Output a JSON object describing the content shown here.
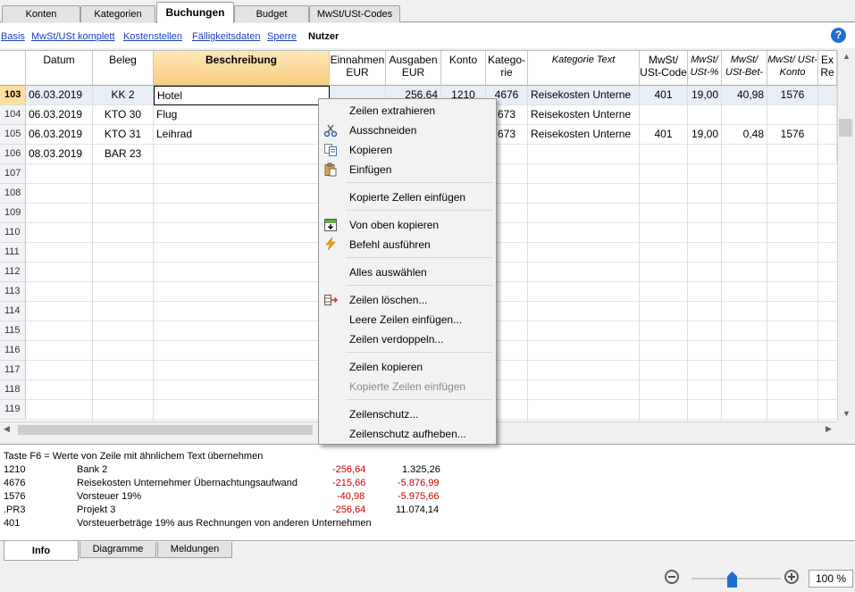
{
  "tabs": [
    "Konten",
    "Kategorien",
    "Buchungen",
    "Budget",
    "MwSt/USt-Codes"
  ],
  "views": [
    "Basis",
    "MwSt/USt komplett",
    "Kostenstellen",
    "Fälligkeitsdaten",
    "Sperre",
    "Nutzer"
  ],
  "columns": {
    "datum": "Datum",
    "beleg": "Beleg",
    "beschreibung": "Beschreibung",
    "einnahmen": "Einnahmen EUR",
    "ausgaben": "Ausgaben EUR",
    "konto": "Konto",
    "kategorie": "Katego-rie",
    "kategorie_text": "Kategorie Text",
    "mwst_code": "MwSt/ USt-Code",
    "mwst_pct": "MwSt/ USt-%",
    "mwst_bet": "MwSt/ USt-Bet-",
    "mwst_konto": "MwSt/ USt-Konto",
    "extra": "Ex Re"
  },
  "rows": [
    {
      "nr": "103",
      "datum": "06.03.2019",
      "beleg": "KK 2",
      "beschreibung": "Hotel",
      "einnahmen": "",
      "ausgaben": "256,64",
      "konto": "1210",
      "kategorie": "4676",
      "kategorie_text": "Reisekosten Unterne",
      "mwst_code": "401",
      "mwst_pct": "19,00",
      "mwst_bet": "40,98",
      "mwst_konto": "1576"
    },
    {
      "nr": "104",
      "datum": "06.03.2019",
      "beleg": "KTO 30",
      "beschreibung": "Flug",
      "einnahmen": "",
      "ausgaben": "",
      "konto": "",
      "kategorie": "673",
      "kategorie_text": "Reisekosten Unterne",
      "mwst_code": "",
      "mwst_pct": "",
      "mwst_bet": "",
      "mwst_konto": ""
    },
    {
      "nr": "105",
      "datum": "06.03.2019",
      "beleg": "KTO 31",
      "beschreibung": "Leihrad",
      "einnahmen": "",
      "ausgaben": "",
      "konto": "",
      "kategorie": "673",
      "kategorie_text": "Reisekosten Unterne",
      "mwst_code": "401",
      "mwst_pct": "19,00",
      "mwst_bet": "0,48",
      "mwst_konto": "1576"
    },
    {
      "nr": "106",
      "datum": "08.03.2019",
      "beleg": "BAR 23",
      "beschreibung": "",
      "einnahmen": "",
      "ausgaben": "",
      "konto": "",
      "kategorie": "",
      "kategorie_text": "",
      "mwst_code": "",
      "mwst_pct": "",
      "mwst_bet": "",
      "mwst_konto": ""
    }
  ],
  "empty_rows": [
    "107",
    "108",
    "109",
    "110",
    "111",
    "112",
    "113",
    "114",
    "115",
    "116",
    "117",
    "118",
    "119"
  ],
  "context_menu": {
    "zeilen_extrahieren": "Zeilen extrahieren",
    "ausschneiden": "Ausschneiden",
    "kopieren": "Kopieren",
    "einfuegen": "Einfügen",
    "kopierte_zellen_einfuegen": "Kopierte Zellen einfügen",
    "von_oben_kopieren": "Von oben kopieren",
    "befehl_ausfuehren": "Befehl ausführen",
    "alles_auswaehlen": "Alles auswählen",
    "zeilen_loeschen": "Zeilen löschen...",
    "leere_zeilen_einfuegen": "Leere Zeilen einfügen...",
    "zeilen_verdoppeln": "Zeilen verdoppeln...",
    "zeilen_kopieren": "Zeilen kopieren",
    "kopierte_zeilen_einfuegen": "Kopierte Zeilen  einfügen",
    "zeilenschutz": "Zeilenschutz...",
    "zeilenschutz_aufheben": "Zeilenschutz aufheben..."
  },
  "info": {
    "hint": "Taste F6 = Werte von Zeile mit ähnlichem Text übernehmen",
    "lines": [
      {
        "code": "1210",
        "text": "Bank 2",
        "amount": "-256,64",
        "balance": "1.325,26",
        "balance_neg": false
      },
      {
        "code": "4676",
        "text": "Reisekosten Unternehmer Übernachtungsaufwand",
        "amount": "-215,66",
        "balance": "-5.876,99",
        "balance_neg": true
      },
      {
        "code": "1576",
        "text": "Vorsteuer 19%",
        "amount": "-40,98",
        "balance": "-5.975,66",
        "balance_neg": true
      },
      {
        "code": ".PR3",
        "text": "Projekt 3",
        "amount": "-256,64",
        "balance": "11.074,14",
        "balance_neg": false
      },
      {
        "code": "401",
        "text": "Vorsteuerbeträge 19% aus Rechnungen von anderen Unternehmen",
        "amount": "",
        "balance": "",
        "balance_neg": false
      }
    ]
  },
  "bottom_tabs": [
    "Info",
    "Diagramme",
    "Meldungen"
  ],
  "zoom": "100 %",
  "colors": {
    "accent": "#1f6fd1",
    "negative": "#d00000",
    "highlight": "#fde0a0"
  }
}
